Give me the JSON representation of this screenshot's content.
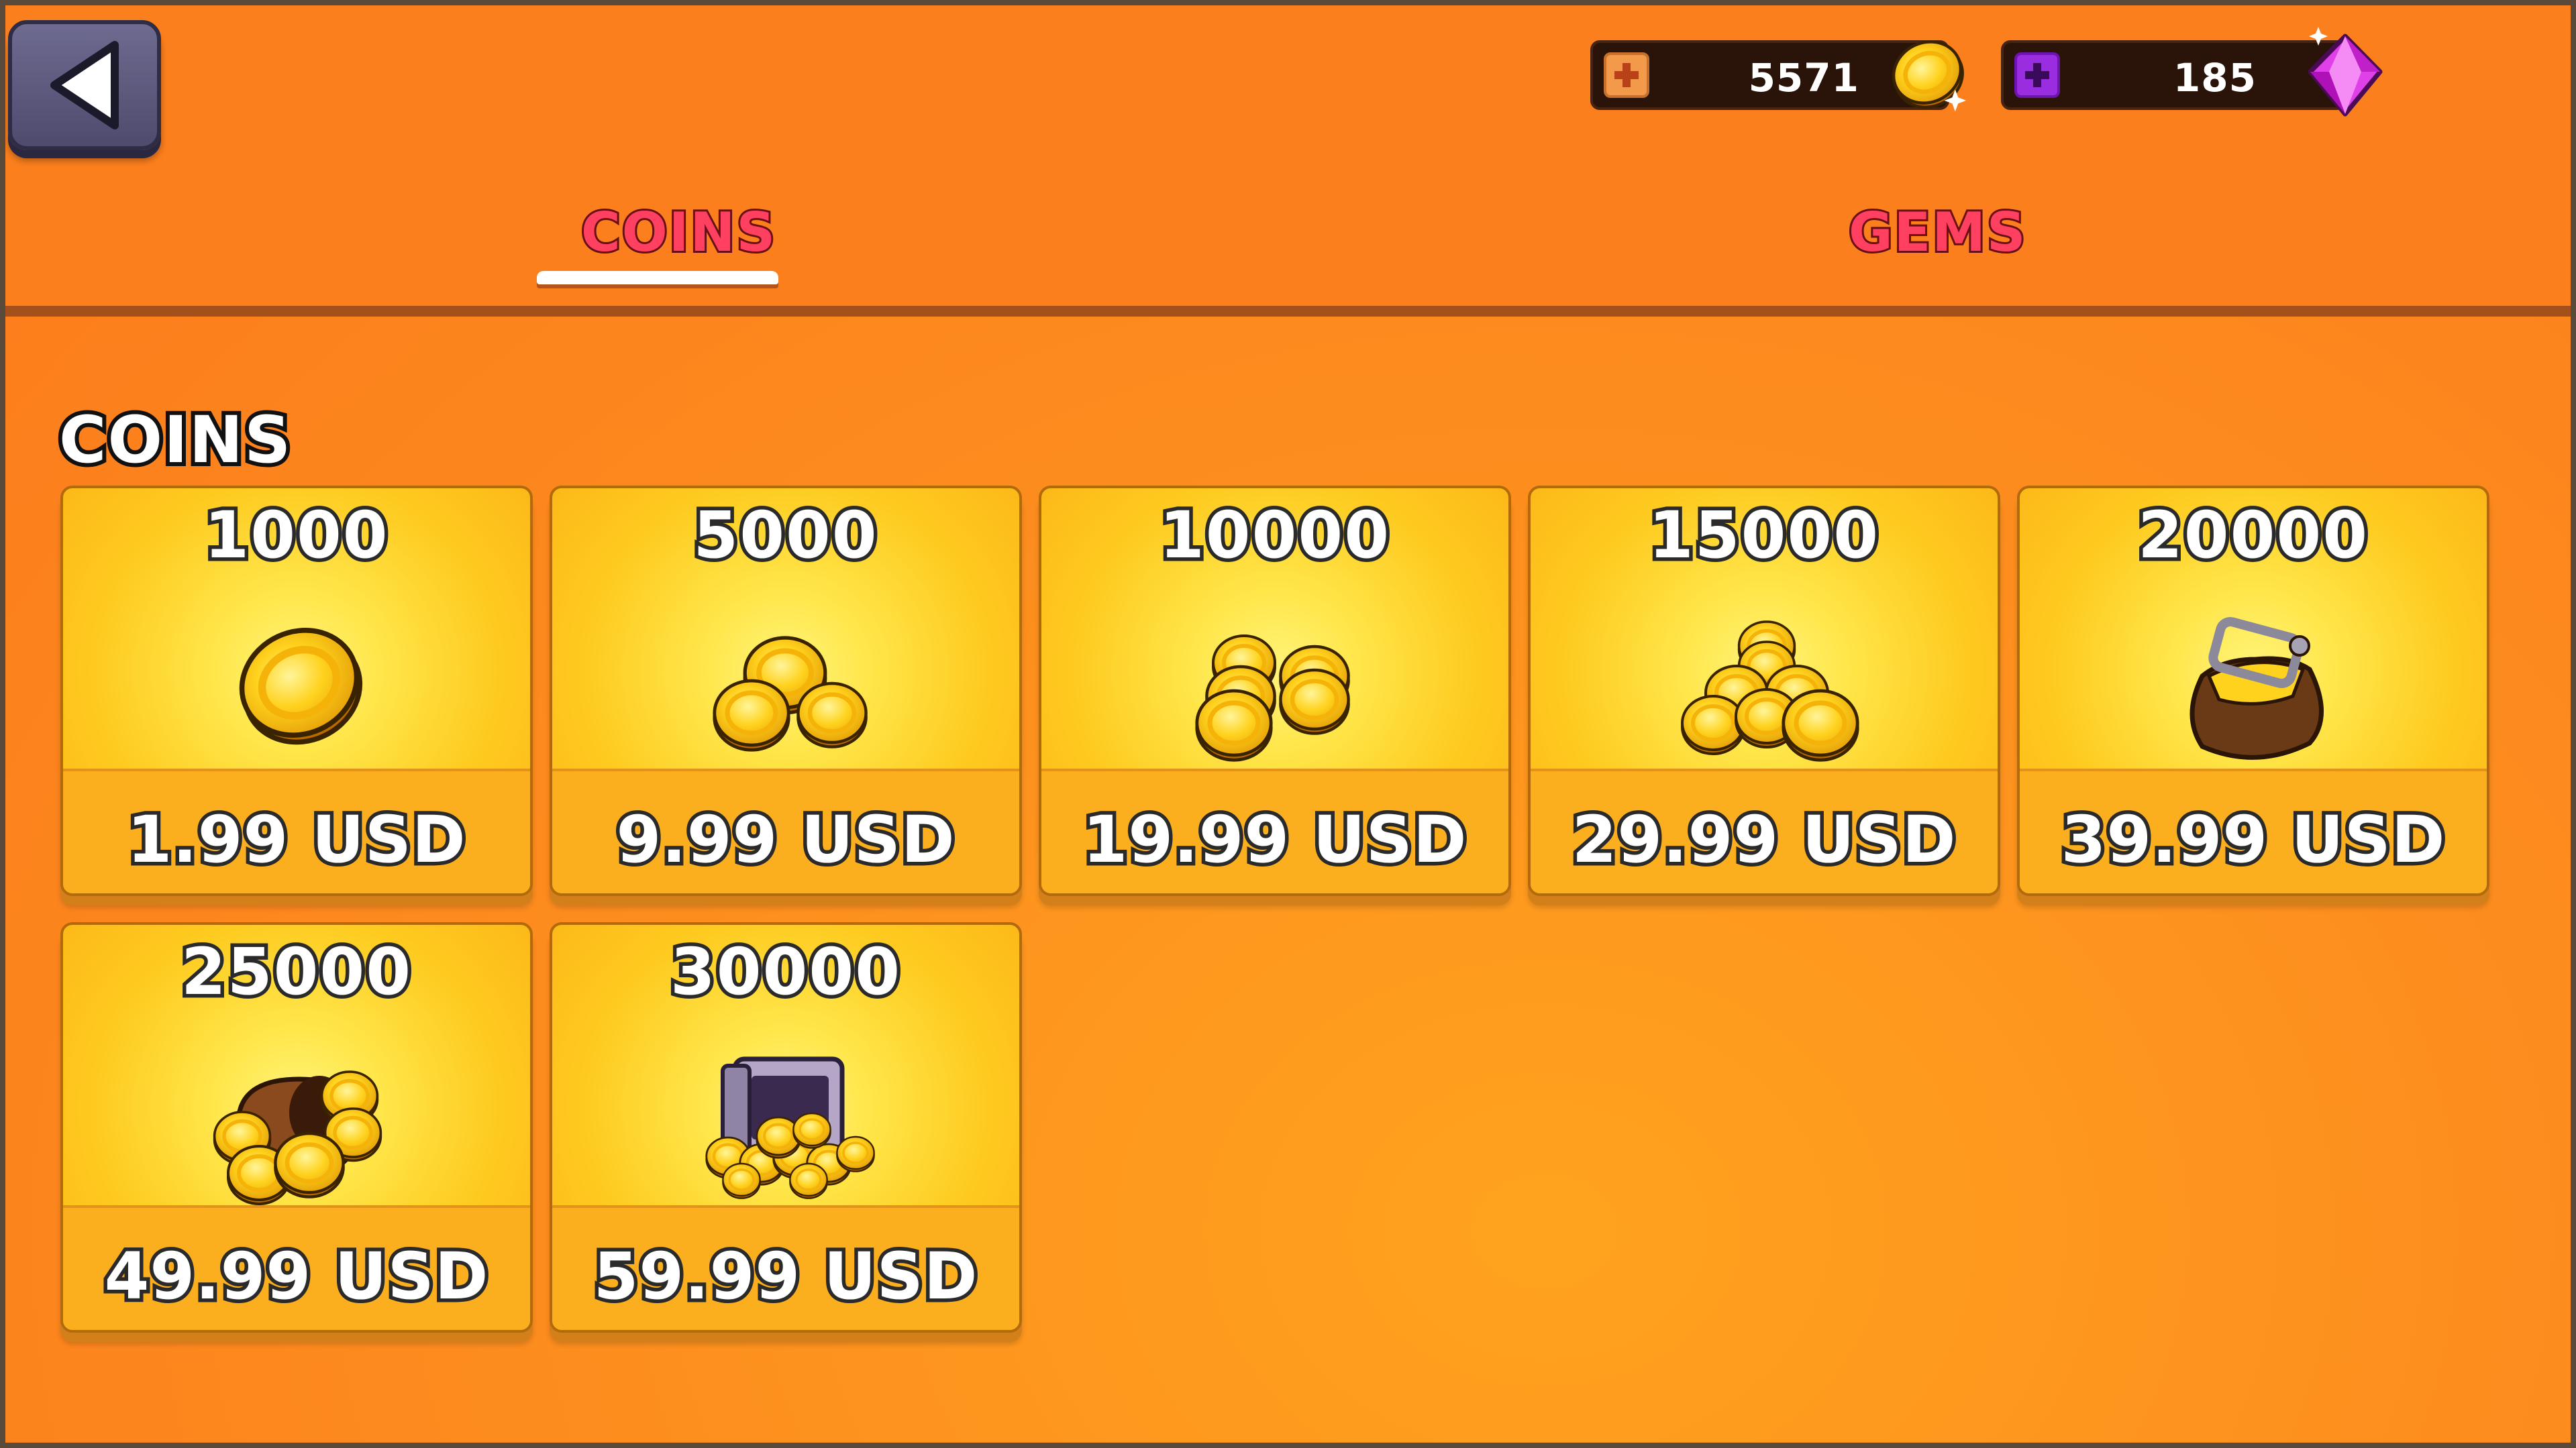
{
  "header": {
    "back_icon": "back-arrow-icon",
    "coin_balance": "5571",
    "gem_balance": "185",
    "coin_add_icon": "plus-icon",
    "gem_add_icon": "plus-icon"
  },
  "tabs": [
    {
      "label": "COINS",
      "active": true
    },
    {
      "label": "GEMS",
      "active": false
    }
  ],
  "section": {
    "title": "COINS"
  },
  "offers": [
    {
      "amount": "1000",
      "price": "1.99 USD",
      "icon": "single-coin"
    },
    {
      "amount": "5000",
      "price": "9.99 USD",
      "icon": "coin-pile-small"
    },
    {
      "amount": "10000",
      "price": "19.99 USD",
      "icon": "coin-stacks"
    },
    {
      "amount": "15000",
      "price": "29.99 USD",
      "icon": "coin-pyramid"
    },
    {
      "amount": "20000",
      "price": "39.99 USD",
      "icon": "coin-purse"
    },
    {
      "amount": "25000",
      "price": "49.99 USD",
      "icon": "coin-sack"
    },
    {
      "amount": "30000",
      "price": "59.99 USD",
      "icon": "coin-safe"
    }
  ],
  "colors": {
    "background": "#fc7f1d",
    "tab_text": "#ff4060",
    "card_gold": "#fecb20",
    "gem": "#e040e8",
    "coin": "#ffc420"
  }
}
